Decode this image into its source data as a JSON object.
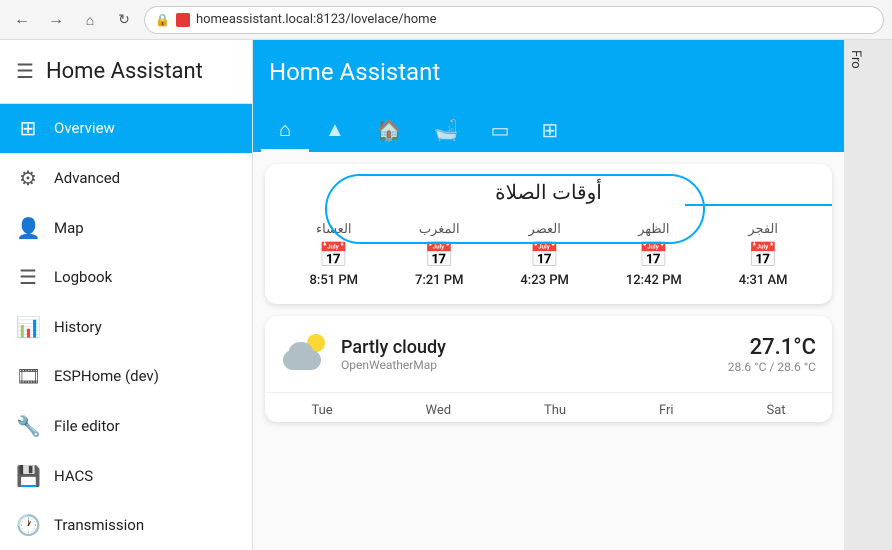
{
  "browser": {
    "url": "homeassistant.local:8123/lovelace/home",
    "back_label": "←",
    "forward_label": "→",
    "home_label": "⌂",
    "reload_label": "↻"
  },
  "sidebar": {
    "title": "Home Assistant",
    "menu_icon": "☰",
    "items": [
      {
        "id": "overview",
        "label": "Overview",
        "icon": "⊞",
        "active": true
      },
      {
        "id": "advanced",
        "label": "Advanced",
        "icon": "⚙",
        "active": false
      },
      {
        "id": "map",
        "label": "Map",
        "icon": "👤",
        "active": false
      },
      {
        "id": "logbook",
        "label": "Logbook",
        "icon": "☰",
        "active": false
      },
      {
        "id": "history",
        "label": "History",
        "icon": "📊",
        "active": false
      },
      {
        "id": "esphome",
        "label": "ESPHome (dev)",
        "icon": "🎞",
        "active": false
      },
      {
        "id": "file-editor",
        "label": "File editor",
        "icon": "🔧",
        "active": false
      },
      {
        "id": "hacs",
        "label": "HACS",
        "icon": "💾",
        "active": false
      },
      {
        "id": "transmission",
        "label": "Transmission",
        "icon": "🕐",
        "active": false
      }
    ]
  },
  "header": {
    "title": "Home Assistant"
  },
  "tabs": [
    {
      "id": "home",
      "icon": "⌂",
      "active": true
    },
    {
      "id": "person",
      "icon": "▲",
      "active": false
    },
    {
      "id": "home2",
      "icon": "🏠",
      "active": false
    },
    {
      "id": "bath",
      "icon": "🛁",
      "active": false
    },
    {
      "id": "display",
      "icon": "▭",
      "active": false
    },
    {
      "id": "grid",
      "icon": "⊞",
      "active": false
    }
  ],
  "prayer_card": {
    "title": "أوقات الصلاة",
    "times": [
      {
        "name": "الفجر",
        "time": "4:31 AM"
      },
      {
        "name": "الظهر",
        "time": "12:42 PM"
      },
      {
        "name": "العصر",
        "time": "4:23 PM"
      },
      {
        "name": "المغرب",
        "time": "7:21 PM"
      },
      {
        "name": "العشاء",
        "time": "8:51 PM"
      }
    ]
  },
  "weather_card": {
    "description": "Partly cloudy",
    "source": "OpenWeatherMap",
    "temp_main": "27.1°C",
    "temp_range": "28.6 °C / 28.6 °C",
    "days": [
      "Tue",
      "Wed",
      "Thu",
      "Fri",
      "Sat"
    ]
  },
  "right_panel": {
    "label": "Fro"
  }
}
